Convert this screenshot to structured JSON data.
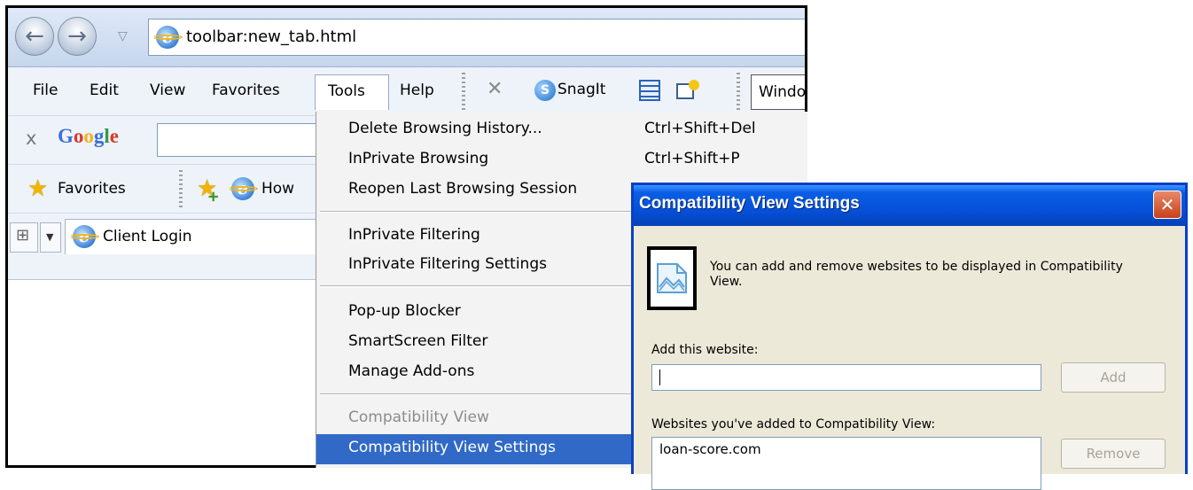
{
  "browser": {
    "address": "toolbar:new_tab.html",
    "menu": [
      "File",
      "Edit",
      "View",
      "Favorites",
      "Tools",
      "Help"
    ],
    "toolbar": {
      "snagit_label": "SnagIt",
      "window_box_text": "Windo"
    },
    "google": {
      "logo": "Google"
    },
    "favorites": {
      "label": "Favorites",
      "how_label": "How"
    },
    "tabs": {
      "client_login": "Client Login"
    }
  },
  "tools_menu": {
    "items": [
      {
        "label": "Delete Browsing History...",
        "shortcut": "Ctrl+Shift+Del"
      },
      {
        "label": "InPrivate Browsing",
        "shortcut": "Ctrl+Shift+P"
      },
      {
        "label": "Reopen Last Browsing Session",
        "shortcut": ""
      },
      {
        "label": "InPrivate Filtering",
        "shortcut": ""
      },
      {
        "label": "InPrivate Filtering Settings",
        "shortcut": ""
      },
      {
        "label": "Pop-up Blocker",
        "shortcut": ""
      },
      {
        "label": "SmartScreen Filter",
        "shortcut": ""
      },
      {
        "label": "Manage Add-ons",
        "shortcut": ""
      },
      {
        "label": "Compatibility View",
        "shortcut": "",
        "disabled": true
      },
      {
        "label": "Compatibility View Settings",
        "shortcut": "",
        "active": true
      }
    ]
  },
  "dialog": {
    "title": "Compatibility View Settings",
    "description": "You can add and remove websites to be displayed in Compatibility View.",
    "add_label": "Add this website:",
    "add_value": "",
    "add_button": "Add",
    "added_label": "Websites you've added to Compatibility View:",
    "sites": [
      "loan-score.com"
    ],
    "remove_button": "Remove"
  },
  "colors": {
    "menu_highlight": "#3169c6",
    "dialog_title": "#0650da",
    "dialog_body": "#ece9d8",
    "close_button": "#c8401b"
  },
  "icons": [
    "back-icon",
    "forward-icon",
    "ie-icon",
    "close-icon",
    "snagit-icon",
    "star-icon",
    "add-favorite-icon",
    "quick-tabs-icon",
    "compatibility-view-icon"
  ]
}
